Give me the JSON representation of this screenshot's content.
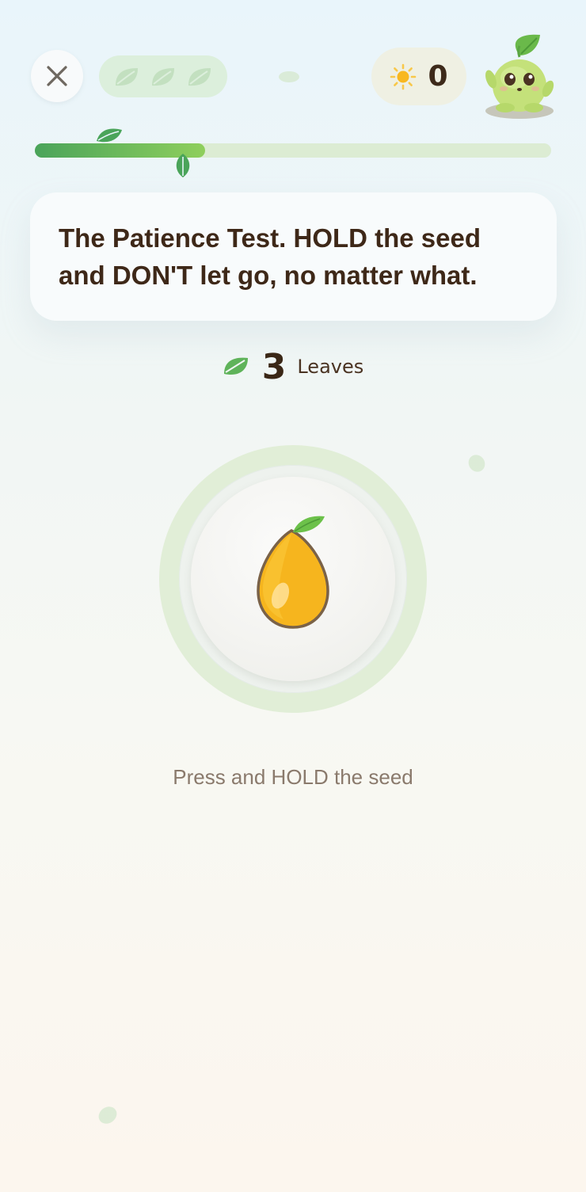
{
  "header": {
    "close_icon": "close-icon",
    "lives": [
      "leaf-icon",
      "leaf-icon",
      "leaf-icon"
    ],
    "sun_icon": "sun-icon",
    "sun_count": "0",
    "mascot": "sprout-mascot"
  },
  "progress": {
    "fraction": 0.33
  },
  "prompt": {
    "line1": "The Patience Test. HOLD the seed",
    "line2": "and DON'T let go, no matter what."
  },
  "leaves": {
    "count": "3",
    "label": "Leaves"
  },
  "seed": {
    "icon": "seed-icon"
  },
  "instruction": "Press and HOLD the seed",
  "colors": {
    "accent_green": "#4aa45a",
    "seed_yellow": "#f6b51e",
    "text_dark": "#3e2818"
  }
}
